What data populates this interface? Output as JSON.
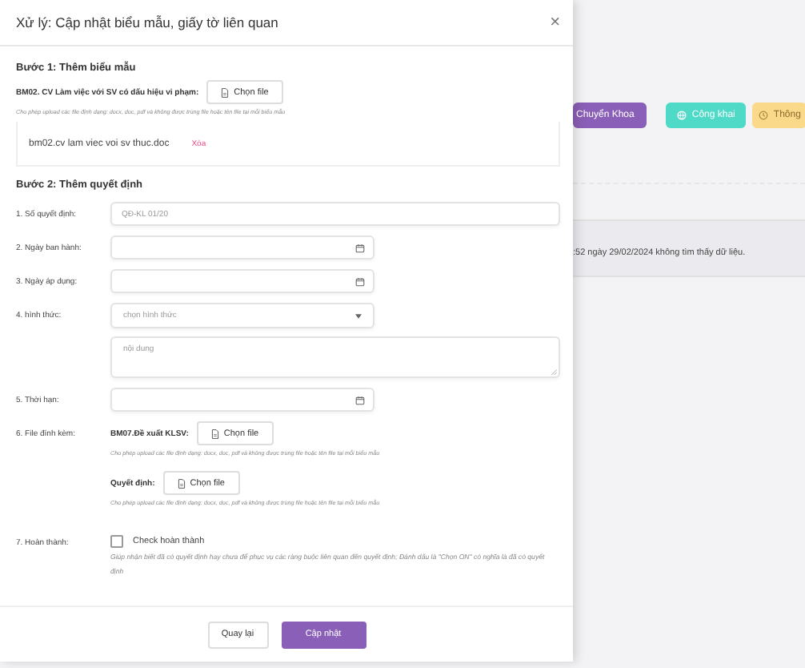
{
  "background": {
    "buttons": [
      {
        "label": "Chuyển Khoa",
        "kind": "purple"
      },
      {
        "label": "Công khai",
        "kind": "teal"
      },
      {
        "label": "Thông",
        "kind": "yellow"
      }
    ],
    "notice": ":52 ngày 29/02/2024 không tìm thấy dữ liệu."
  },
  "modal": {
    "title": "Xử lý: Cập nhật biểu mẫu, giấy tờ liên quan",
    "close": "×",
    "step1": {
      "heading": "Bước 1: Thêm biểu mẫu",
      "file_label": "BM02. CV Làm việc với SV có dấu hiệu vi phạm:",
      "button": "Chọn file",
      "hint": "Cho phép upload các file định dạng: docx, doc, pdf và không được trùng file hoặc tên file tại mỗi biểu mẫu",
      "uploaded": {
        "name": "bm02.cv lam viec voi sv thuc.doc",
        "delete": "Xóa"
      }
    },
    "step2": {
      "heading": "Bước 2: Thêm quyết định",
      "fields": [
        {
          "kind": "text",
          "label": "1. Số quyết định:",
          "placeholder": "QĐ-KL 01/20"
        },
        {
          "kind": "date",
          "label": "2. Ngày ban hành:"
        },
        {
          "kind": "date",
          "label": "3. Ngày áp dụng:"
        },
        {
          "kind": "select",
          "label": "4. hình thức:",
          "placeholder": "chọn hình thức"
        },
        {
          "kind": "textarea",
          "placeholder": "nội dung"
        },
        {
          "kind": "date",
          "label": "5. Thời hạn:"
        },
        {
          "kind": "files",
          "label": "6. File đính kèm:",
          "files": [
            {
              "label": "BM07.Đề xuất KLSV:",
              "button": "Chọn file",
              "hint": "Cho phép upload các file định dạng: docx, doc, pdf và không được trùng file hoặc tên file tại mỗi biểu mẫu"
            },
            {
              "label": "Quyết định:",
              "button": "Chọn file",
              "hint": "Cho phép upload các file định dạng: docx, doc, pdf và không được trùng file hoặc tên file tại mỗi biểu mẫu"
            }
          ]
        },
        {
          "kind": "check",
          "label": "7. Hoàn thành:",
          "check_label": "Check hoàn thành",
          "checked": false,
          "hint": "Giúp nhận biết đã có quyết định hay chưa để phục vụ các ràng buộc liên quan đến quyết định; Đánh dấu là \"Chọn ON\" có nghĩa là đã có quyết định"
        }
      ]
    },
    "footer": {
      "back": "Quay lại",
      "submit": "Cập nhật"
    }
  }
}
